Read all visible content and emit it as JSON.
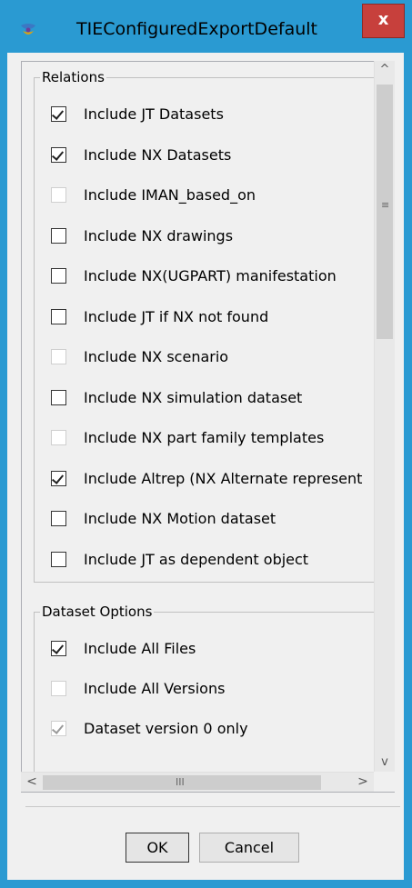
{
  "window": {
    "title": "TIEConfiguredExportDefault",
    "close_label": "x",
    "accent": "#2a9ad2",
    "close_color": "#c7403c"
  },
  "relations": {
    "legend": "Relations",
    "items": [
      {
        "label": "Include JT Datasets",
        "checked": true,
        "enabled": true
      },
      {
        "label": "Include NX Datasets",
        "checked": true,
        "enabled": true
      },
      {
        "label": "Include IMAN_based_on",
        "checked": false,
        "enabled": false
      },
      {
        "label": "Include NX drawings",
        "checked": false,
        "enabled": true
      },
      {
        "label": "Include NX(UGPART) manifestation",
        "checked": false,
        "enabled": true
      },
      {
        "label": "Include JT if NX not found",
        "checked": false,
        "enabled": true
      },
      {
        "label": "Include NX scenario",
        "checked": false,
        "enabled": false
      },
      {
        "label": "Include NX simulation dataset",
        "checked": false,
        "enabled": true
      },
      {
        "label": "Include NX part family templates",
        "checked": false,
        "enabled": false
      },
      {
        "label": "Include Altrep (NX Alternate represent",
        "checked": true,
        "enabled": true
      },
      {
        "label": "Include NX Motion dataset",
        "checked": false,
        "enabled": true
      },
      {
        "label": "Include JT as dependent object",
        "checked": false,
        "enabled": true
      }
    ]
  },
  "dataset_options": {
    "legend": "Dataset Options",
    "items": [
      {
        "label": "Include All Files",
        "checked": true,
        "enabled": true
      },
      {
        "label": "Include All Versions",
        "checked": false,
        "enabled": false
      },
      {
        "label": "Dataset version 0 only",
        "checked": true,
        "enabled": false
      }
    ]
  },
  "scrollbars": {
    "vertical_grip": "≡",
    "horizontal_grip": "III",
    "up_arrow": "^",
    "down_arrow": "v",
    "left_arrow": "<",
    "right_arrow": ">"
  },
  "buttons": {
    "ok": "OK",
    "cancel": "Cancel"
  }
}
